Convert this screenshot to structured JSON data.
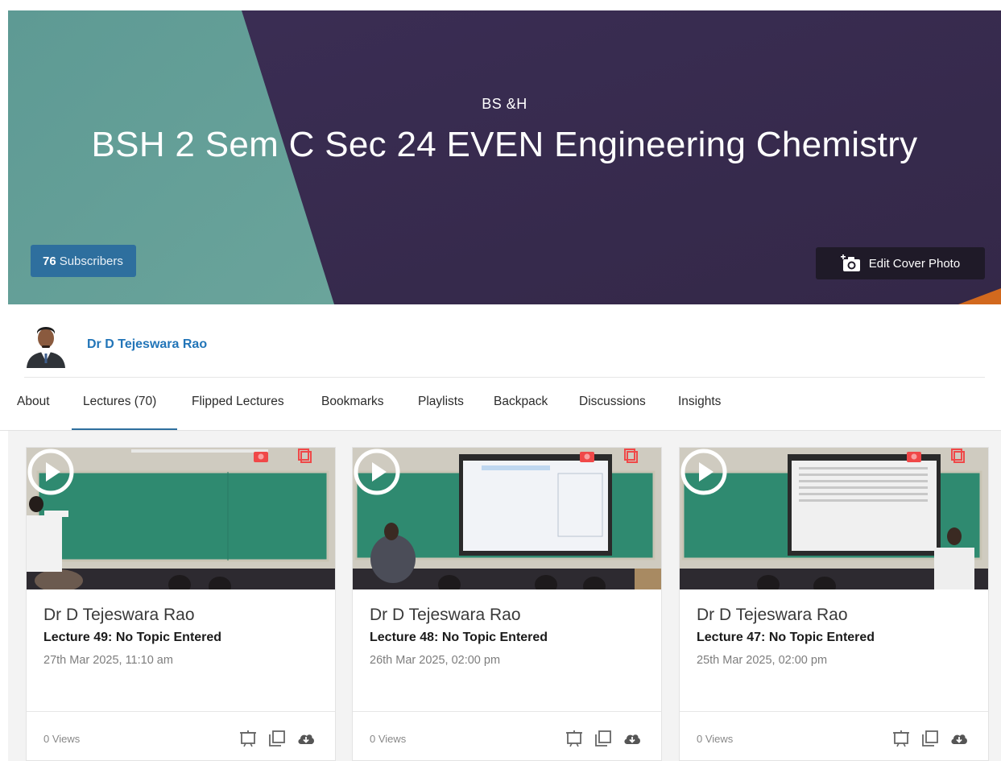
{
  "cover": {
    "department": "BS &H",
    "title": "BSH 2 Sem C Sec 24 EVEN Engineering Chemistry",
    "subscribers_count": "76",
    "subscribers_label": "Subscribers",
    "edit_cover_label": "Edit Cover Photo",
    "colors": {
      "teal": "#5e9a94",
      "purple": "#3a2d52",
      "accent": "#d2691e"
    }
  },
  "owner": {
    "name": "Dr D Tejeswara Rao"
  },
  "tabs": [
    {
      "label": "About"
    },
    {
      "label": "Lectures (70)"
    },
    {
      "label": "Flipped Lectures"
    },
    {
      "label": "Bookmarks"
    },
    {
      "label": "Playlists"
    },
    {
      "label": "Backpack"
    },
    {
      "label": "Discussions"
    },
    {
      "label": "Insights"
    }
  ],
  "active_tab": "Lectures (70)",
  "lectures": [
    {
      "author": "Dr D Tejeswara Rao",
      "title": "Lecture 49: No Topic Entered",
      "date": "27th Mar 2025, 11:10 am",
      "views": "0 Views"
    },
    {
      "author": "Dr D Tejeswara Rao",
      "title": "Lecture 48: No Topic Entered",
      "date": "26th Mar 2025, 02:00 pm",
      "views": "0 Views"
    },
    {
      "author": "Dr D Tejeswara Rao",
      "title": "Lecture 47: No Topic Entered",
      "date": "25th Mar 2025, 02:00 pm",
      "views": "0 Views"
    }
  ],
  "icons": [
    "camera-plus-icon",
    "play-icon",
    "snapshot-icon",
    "copy-icon",
    "presentation-icon",
    "duplicate-icon",
    "cloud-download-icon"
  ]
}
